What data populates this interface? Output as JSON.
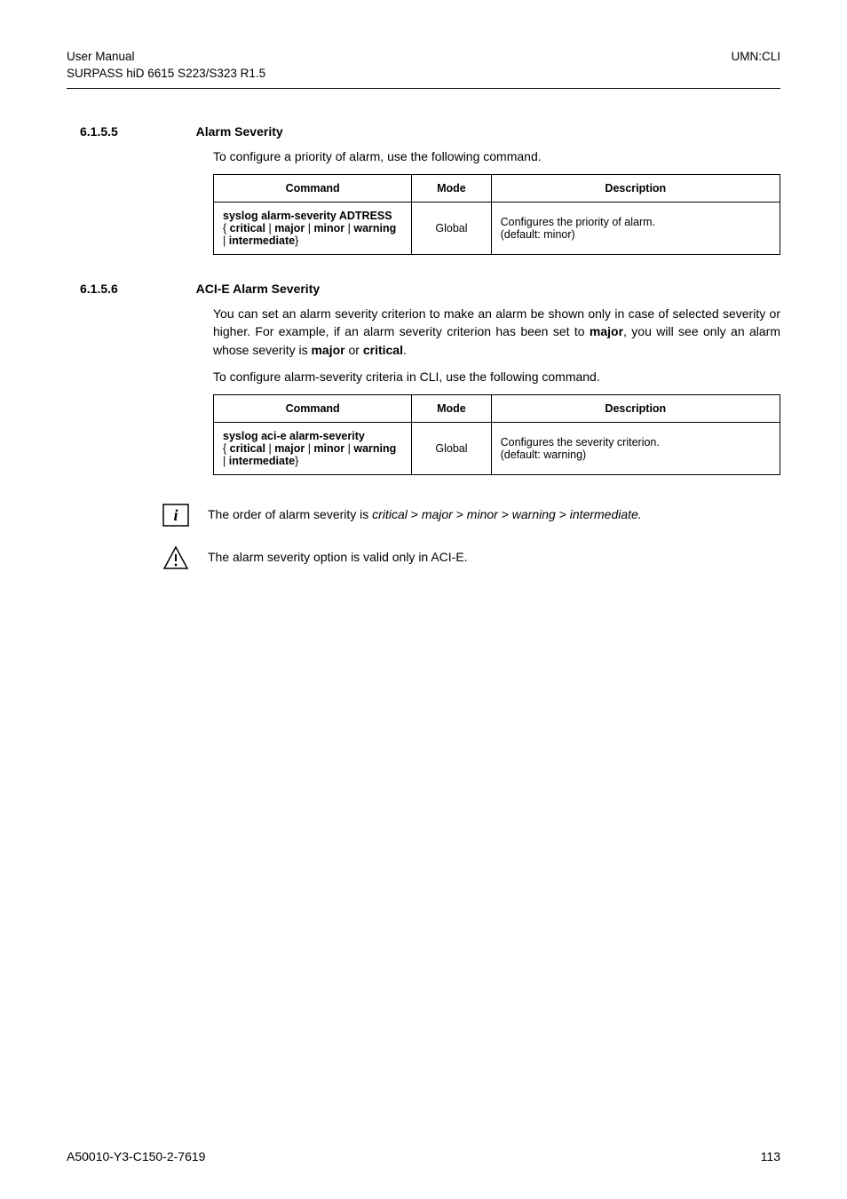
{
  "header": {
    "left_line1": "User Manual",
    "left_line2": "SURPASS hiD 6615 S223/S323 R1.5",
    "right": "UMN:CLI"
  },
  "section1": {
    "number": "6.1.5.5",
    "title": "Alarm Severity",
    "intro": "To configure a priority of alarm, use the following command.",
    "table": {
      "headers": [
        "Command",
        "Mode",
        "Description"
      ],
      "row": {
        "cmd_line1": "syslog alarm-severity ADTRESS",
        "cmd_line2_pre": "{",
        "cmd_opts": [
          "critical",
          "major",
          "minor",
          "warning",
          "intermediate"
        ],
        "cmd_line2_post": "}",
        "mode": "Global",
        "desc_line1": "Configures the priority of alarm.",
        "desc_line2": "(default: minor)"
      }
    }
  },
  "section2": {
    "number": "6.1.5.6",
    "title": "ACI-E Alarm Severity",
    "para_parts": {
      "p1a": "You can set an alarm severity criterion to make an alarm be shown only in case of selected severity or higher. For example, if an alarm severity criterion has been set to ",
      "p1b": "major",
      "p1c": ", you will see only an alarm whose severity is ",
      "p1d": "major",
      "p1e": " or ",
      "p1f": "critical",
      "p1g": "."
    },
    "intro2": "To configure alarm-severity criteria in CLI, use the following command.",
    "table": {
      "headers": [
        "Command",
        "Mode",
        "Description"
      ],
      "row": {
        "cmd_line1": "syslog aci-e alarm-severity",
        "cmd_line2_pre": "{",
        "cmd_opts": [
          "critical",
          "major",
          "minor",
          "warning",
          "intermediate"
        ],
        "cmd_line2_post": "}",
        "mode": "Global",
        "desc_line1": "Configures the severity criterion.",
        "desc_line2": "(default: warning)"
      }
    },
    "note": {
      "pre": "The order of alarm severity is ",
      "seq": [
        "critical",
        "major",
        "minor",
        "warning",
        "intermediate"
      ],
      "sep": " > ",
      "post": "."
    },
    "caution": "The alarm severity option is valid only in ACI-E."
  },
  "footer": {
    "left": "A50010-Y3-C150-2-7619",
    "right": "113"
  }
}
